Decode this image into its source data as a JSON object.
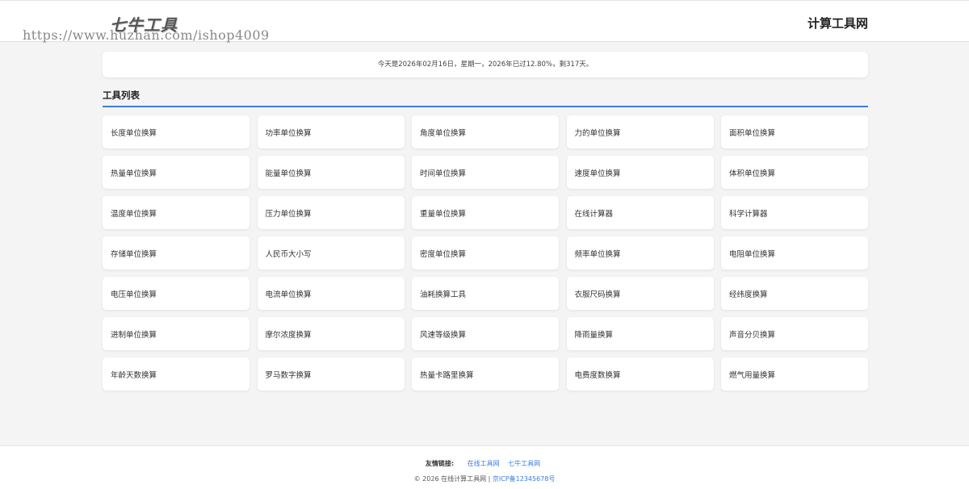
{
  "header": {
    "logo": "七牛工具",
    "watermark": "https://www.huzhan.com/ishop4009",
    "site_title": "计算工具网"
  },
  "date_bar": {
    "text": "今天是2026年02月16日，星期一，2026年已过12.80%，剩317天。"
  },
  "section": {
    "title": "工具列表"
  },
  "tools": [
    "长度单位换算",
    "功率单位换算",
    "角度单位换算",
    "力的单位换算",
    "面积单位换算",
    "热量单位换算",
    "能量单位换算",
    "时间单位换算",
    "速度单位换算",
    "体积单位换算",
    "温度单位换算",
    "压力单位换算",
    "重量单位换算",
    "在线计算器",
    "科学计算器",
    "存储单位换算",
    "人民币大小写",
    "密度单位换算",
    "频率单位换算",
    "电阻单位换算",
    "电压单位换算",
    "电流单位换算",
    "油耗换算工具",
    "衣服尺码换算",
    "经纬度换算",
    "进制单位换算",
    "摩尔浓度换算",
    "风速等级换算",
    "降雨量换算",
    "声音分贝换算",
    "年龄天数换算",
    "罗马数字换算",
    "热量卡路里换算",
    "电费度数换算",
    "燃气用量换算"
  ],
  "footer": {
    "friend_label": "友情链接:",
    "links": [
      "在线工具网",
      "七牛工具网"
    ],
    "copyright": "© 2026 在线计算工具网 |",
    "icp": "京ICP备12345678号"
  },
  "colors": {
    "accent": "#3b7ddd",
    "background": "#f4f4f4",
    "card": "#ffffff"
  }
}
